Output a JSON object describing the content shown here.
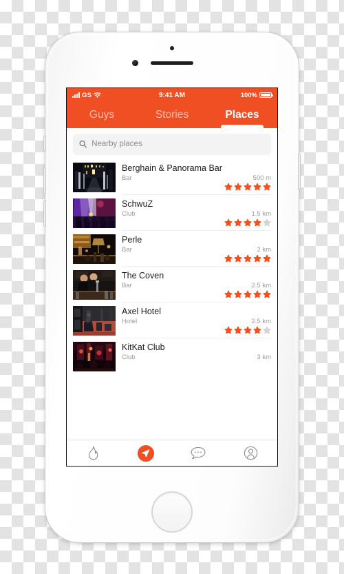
{
  "theme": {
    "accent": "#f04e23",
    "star_on": "#f4511e",
    "star_off": "#d4d4d4"
  },
  "status_bar": {
    "carrier": "GS",
    "time": "9:41 AM",
    "battery_pct": "100%",
    "signal_icon": "signal-bars-icon",
    "wifi_icon": "wifi-icon",
    "battery_icon": "battery-full-icon"
  },
  "top_tabs": [
    {
      "label": "Guys",
      "active": false
    },
    {
      "label": "Stories",
      "active": false
    },
    {
      "label": "Places",
      "active": true
    }
  ],
  "search": {
    "placeholder": "Nearby places",
    "value": "",
    "icon": "search-icon"
  },
  "places": [
    {
      "name": "Berghain & Panorama Bar",
      "category": "Bar",
      "distance": "500 m",
      "rating": 5,
      "thumb": "night-street-lights"
    },
    {
      "name": "SchwuZ",
      "category": "Club",
      "distance": "1.5 km",
      "rating": 4,
      "thumb": "club-crowd-lights"
    },
    {
      "name": "Perle",
      "category": "Bar",
      "distance": "2 km",
      "rating": 5,
      "thumb": "warm-bar-interior"
    },
    {
      "name": "The Coven",
      "category": "Bar",
      "distance": "2.5 km",
      "rating": 5,
      "thumb": "bartenders-counter"
    },
    {
      "name": "Axel Hotel",
      "category": "Hotel",
      "distance": "2.5 km",
      "rating": 4,
      "thumb": "hotel-gym-room"
    },
    {
      "name": "KitKat Club",
      "category": "Club",
      "distance": "3 km",
      "rating": 0,
      "thumb": "red-neon-club"
    }
  ],
  "bottom_tabs": [
    {
      "name": "flame",
      "icon": "flame-icon",
      "active": false
    },
    {
      "name": "explore",
      "icon": "navigation-arrow-icon",
      "active": true
    },
    {
      "name": "chat",
      "icon": "chat-bubble-icon",
      "active": false
    },
    {
      "name": "profile",
      "icon": "profile-person-icon",
      "active": false
    }
  ],
  "device": {
    "earpiece": "earpiece-speaker",
    "front_camera": "front-camera",
    "sensor": "proximity-sensor",
    "home_button": "home-button"
  }
}
